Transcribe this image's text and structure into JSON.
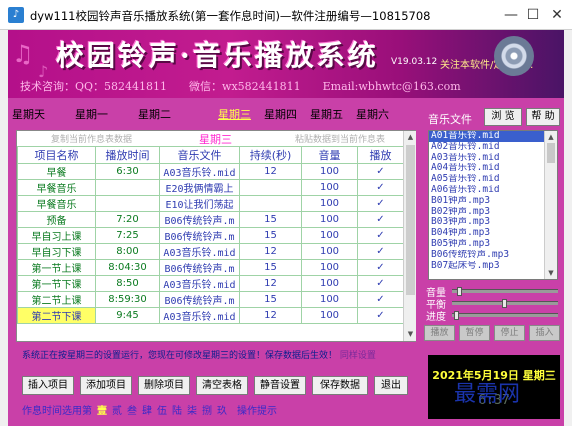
{
  "window": {
    "title": "dyw111校园铃声音乐播放系统(第一套作息时间)—软件注册编号—10815708",
    "min_icon": "minimize-icon",
    "max_icon": "maximize-icon",
    "close_icon": "close-icon"
  },
  "banner": {
    "title": "校园铃声·音乐播放系统",
    "version": "V19.03.12",
    "about": "关注本软件/定软件…",
    "contact": "技术咨询：QQ：582441811　　微信：wx582441811　　Email:wbhwtc@163.com"
  },
  "days": [
    "星期天",
    "星期一",
    "星期二",
    "星期三",
    "星期四",
    "星期五",
    "星期六"
  ],
  "active_day_index": 3,
  "table": {
    "copy_hint": "复制当前作息表数据",
    "current_day": "星期三",
    "paste_hint": "粘贴数据到当前作息表",
    "headers": [
      "项目名称",
      "播放时间",
      "音乐文件",
      "持续(秒)",
      "音量",
      "播放"
    ],
    "rows": [
      {
        "name": "早餐",
        "time": "6:30",
        "file": "A03音乐铃.mid",
        "duration": "12",
        "volume": "100",
        "play": "✓"
      },
      {
        "name": "早餐音乐",
        "time": "",
        "file": "E20我俩情霸上",
        "duration": "",
        "volume": "100",
        "play": "✓"
      },
      {
        "name": "早餐音乐",
        "time": "",
        "file": "E10让我们荡起",
        "duration": "",
        "volume": "100",
        "play": "✓"
      },
      {
        "name": "预备",
        "time": "7:20",
        "file": "B06传统铃声.m",
        "duration": "15",
        "volume": "100",
        "play": "✓"
      },
      {
        "name": "早自习上课",
        "time": "7:25",
        "file": "B06传统铃声.m",
        "duration": "15",
        "volume": "100",
        "play": "✓"
      },
      {
        "name": "早自习下课",
        "time": "8:00",
        "file": "A03音乐铃.mid",
        "duration": "12",
        "volume": "100",
        "play": "✓"
      },
      {
        "name": "第一节上课",
        "time": "8:04:30",
        "file": "B06传统铃声.m",
        "duration": "15",
        "volume": "100",
        "play": "✓"
      },
      {
        "name": "第一节下课",
        "time": "8:50",
        "file": "A03音乐铃.mid",
        "duration": "12",
        "volume": "100",
        "play": "✓"
      },
      {
        "name": "第二节上课",
        "time": "8:59:30",
        "file": "B06传统铃声.m",
        "duration": "15",
        "volume": "100",
        "play": "✓"
      },
      {
        "name": "第二节下课",
        "time": "9:45",
        "file": "A03音乐铃.mid",
        "duration": "12",
        "volume": "100",
        "play": "✓"
      }
    ],
    "selected_row_index": 9
  },
  "status": {
    "text": "系统正在按星期三的设置运行，您现在可修改星期三的设置！保存数据后生效！",
    "tail": "同样设置"
  },
  "buttons": [
    "插入项目",
    "添加项目",
    "删除项目",
    "清空表格",
    "静音设置",
    "保存数据",
    "退出"
  ],
  "schemes": {
    "label": "作息时间选用第",
    "items": [
      "壹",
      "贰",
      "叁",
      "肆",
      "伍",
      "陆",
      "柒",
      "捌",
      "玖"
    ],
    "current_index": 0,
    "suffix": "操作提示"
  },
  "right": {
    "music_label": "音乐文件",
    "browse": "浏 览",
    "help": "帮 助",
    "files": [
      "A01音乐铃.mid",
      "A02音乐铃.mid",
      "A03音乐铃.mid",
      "A04音乐铃.mid",
      "A05音乐铃.mid",
      "A06音乐铃.mid",
      "B01钟声.mp3",
      "B02钟声.mp3",
      "B03钟声.mp3",
      "B04钟声.mp3",
      "B05钟声.mp3",
      "B06传统铃声.mp3",
      "B07起床号.mp3"
    ],
    "selected_file_index": 0,
    "volume_label": "音量",
    "balance_label": "平衡",
    "progress_label": "进度",
    "volume_level": 0.05,
    "balance_level": 0.5,
    "progress_level": 0.02,
    "controls": [
      "播放",
      "暂停",
      "停止",
      "插入"
    ]
  },
  "clock": {
    "date": "2021年5月19日 星期三",
    "time": "6:37"
  },
  "watermark": "最需网"
}
